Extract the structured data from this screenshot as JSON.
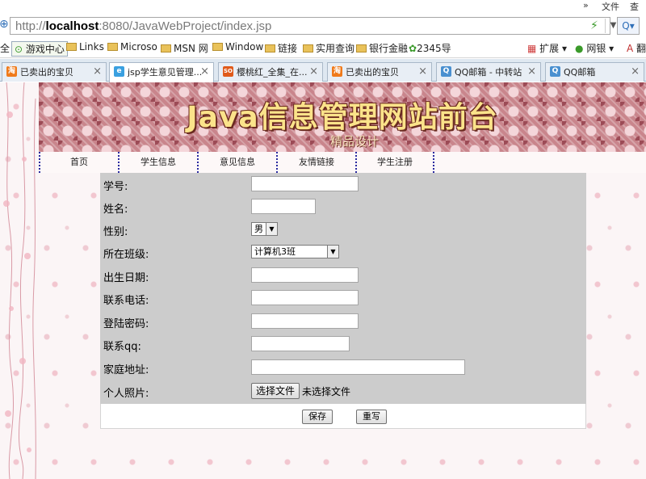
{
  "browser": {
    "menu": [
      "文件",
      "查看"
    ],
    "nav_arrows": "»",
    "address": {
      "scheme": "http://",
      "host": "localhost",
      "rest": ":8080/JavaWebProject/index.jsp"
    },
    "bookmarks": [
      {
        "label": "全",
        "icon": "none"
      },
      {
        "label": "游戏中心",
        "icon": "game-icon"
      },
      {
        "label": "Links",
        "icon": "folder-icon"
      },
      {
        "label": "Microso",
        "icon": "folder-icon"
      },
      {
        "label": "MSN 网",
        "icon": "folder-icon"
      },
      {
        "label": "Window",
        "icon": "folder-icon"
      },
      {
        "label": "链接",
        "icon": "folder-icon"
      },
      {
        "label": "实用查询",
        "icon": "folder-icon"
      },
      {
        "label": "银行金融",
        "icon": "folder-icon"
      },
      {
        "label": "2345导",
        "icon": "site-icon"
      },
      {
        "label": "扩展",
        "icon": "apps-icon"
      },
      {
        "label": "网银",
        "icon": "bank-icon"
      },
      {
        "label": "翻",
        "icon": "translate-icon"
      }
    ],
    "tabs": [
      {
        "label": "已卖出的宝贝",
        "icon_text": "淘",
        "icon_color": "#f07a1a",
        "active": false
      },
      {
        "label": "jsp学生意见管理...",
        "icon_text": "e",
        "icon_color": "#3aa0e0",
        "active": true
      },
      {
        "label": "樱桃红_全集_在...",
        "icon_text": "SO",
        "icon_color": "#e05a1a",
        "active": false
      },
      {
        "label": "已卖出的宝贝",
        "icon_text": "淘",
        "icon_color": "#f07a1a",
        "active": false
      },
      {
        "label": "QQ邮箱 - 中转站",
        "icon_text": "Q",
        "icon_color": "#4a90d0",
        "active": false
      },
      {
        "label": "QQ邮箱",
        "icon_text": "Q",
        "icon_color": "#4a90d0",
        "active": false
      }
    ],
    "tab_close": "×"
  },
  "banner": {
    "title": "Java信息管理网站前台",
    "subtitle": "精品设计"
  },
  "nav": [
    "首页",
    "学生信息",
    "意见信息",
    "友情链接",
    "学生注册"
  ],
  "form": {
    "student_id_label": "学号:",
    "name_label": "姓名:",
    "gender_label": "性别:",
    "gender_value": "男",
    "class_label": "所在班级:",
    "class_value": "计算机3班",
    "birth_label": "出生日期:",
    "phone_label": "联系电话:",
    "password_label": "登陆密码:",
    "qq_label": "联系qq:",
    "address_label": "家庭地址:",
    "photo_label": "个人照片:",
    "file_button": "选择文件",
    "file_status": "未选择文件"
  },
  "buttons": {
    "save": "保存",
    "reset": "重写"
  }
}
